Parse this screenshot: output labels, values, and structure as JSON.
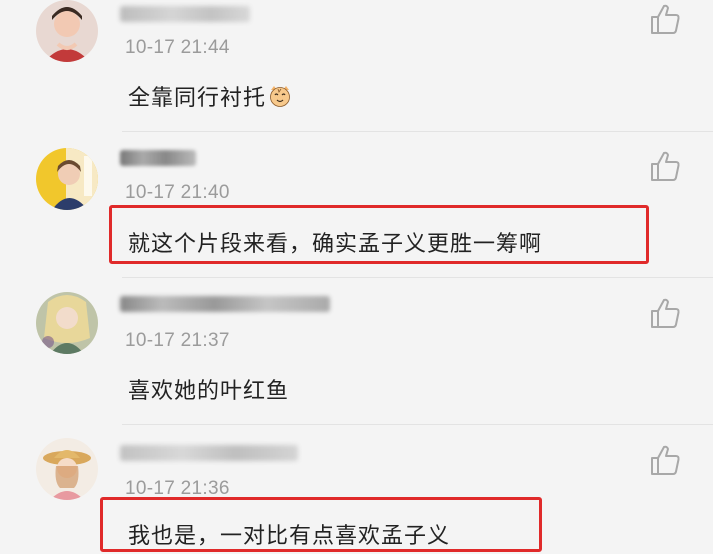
{
  "comments": [
    {
      "username": "",
      "timestamp": "10-17 21:44",
      "text": "全靠同行衬托",
      "emoji": "cat-face-icon",
      "highlighted": false
    },
    {
      "username": "",
      "timestamp": "10-17 21:40",
      "text": "就这个片段来看，确实孟子义更胜一筹啊",
      "highlighted": true
    },
    {
      "username": "",
      "timestamp": "10-17 21:37",
      "text": "喜欢她的叶红鱼",
      "highlighted": false
    },
    {
      "username": "",
      "timestamp": "10-17 21:36",
      "text": "我也是，一对比有点喜欢孟子义",
      "highlighted": true
    }
  ],
  "icons": {
    "like": "thumbs-up-icon"
  },
  "colors": {
    "background": "#f4f4f4",
    "timestamp": "#9b9b9b",
    "text": "#222222",
    "highlight": "#e02a2a",
    "like_icon": "#a8a8a8"
  }
}
